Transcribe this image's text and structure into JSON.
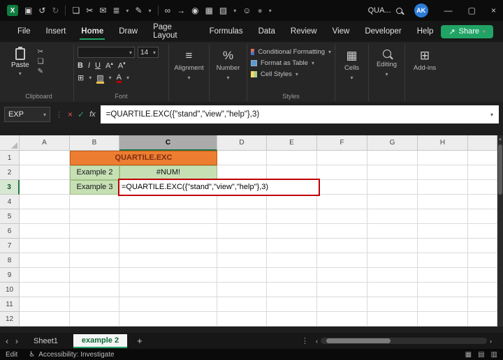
{
  "titlebar": {
    "search_text": "QUA...",
    "avatar_initials": "AK"
  },
  "icons": {
    "logo": "X",
    "save": "▣",
    "undo": "↺",
    "redo": "↻",
    "copy": "❏",
    "cut": "✂",
    "mail": "✉",
    "list": "≣",
    "pen": "✎",
    "link": "∞",
    "arrow": "→",
    "camera": "◉",
    "table": "▦",
    "bucket": "▨",
    "person": "☺",
    "record": "●",
    "chevron": "▾",
    "minimize": "—",
    "maximize": "▢",
    "close": "×",
    "cancel": "×",
    "confirm": "✓",
    "fx": "fx",
    "borders": "⊞",
    "fill": "▨",
    "font_letter": "A",
    "align": "≡",
    "percent": "%",
    "cells": "▦",
    "addins": "⊞",
    "plus": "+",
    "dots": "⋮",
    "nav_left": "‹",
    "nav_right": "›",
    "up": "▴",
    "accessibility": "♿",
    "view_normal": "▦",
    "view_layout": "▤",
    "view_break": "▥",
    "bold": "B",
    "italic": "I",
    "underline": "U",
    "share_arrow": "↗"
  },
  "menu": {
    "items": [
      "File",
      "Insert",
      "Home",
      "Draw",
      "Page Layout",
      "Formulas",
      "Data",
      "Review",
      "View",
      "Developer",
      "Help"
    ],
    "active": "Home",
    "share_label": "Share"
  },
  "ribbon": {
    "paste_label": "Paste",
    "clipboard_group": "Clipboard",
    "font_group": "Font",
    "font_size": "14",
    "alignment_group": "Alignment",
    "number_group": "Number",
    "styles_items": [
      "Conditional Formatting",
      "Format as Table",
      "Cell Styles"
    ],
    "styles_group": "Styles",
    "cells_group": "Cells",
    "editing_group": "Editing",
    "addins_group": "Add-ins"
  },
  "formula_bar": {
    "name_box": "EXP",
    "formula": "=QUARTILE.EXC({\"stand\",\"view\",\"help\"},3)"
  },
  "grid": {
    "column_headers": [
      "A",
      "B",
      "C",
      "D",
      "E",
      "F",
      "G",
      "H",
      ""
    ],
    "row_headers": [
      "1",
      "2",
      "3",
      "4",
      "5",
      "6",
      "7",
      "8",
      "9",
      "10",
      "11",
      "12"
    ],
    "selected_column": "C",
    "selected_row": "3",
    "cells": {
      "title": "QUARTILE.EXC",
      "example2_label": "Example 2",
      "example2_value": "#NUM!",
      "example3_label": "Example 3",
      "example3_formula": "=QUARTILE.EXC({\"stand\",\"view\",\"help\"},3)"
    }
  },
  "tabs": {
    "sheets": [
      "Sheet1",
      "example 2"
    ],
    "active": "example 2"
  },
  "status": {
    "mode": "Edit",
    "accessibility": "Accessibility: Investigate"
  },
  "colors": {
    "accent_green": "#21A366",
    "header_orange": "#ED7D31",
    "cell_green": "#C6E0B4",
    "highlight_red": "#C00000",
    "avatar_blue": "#2D7CD7"
  }
}
